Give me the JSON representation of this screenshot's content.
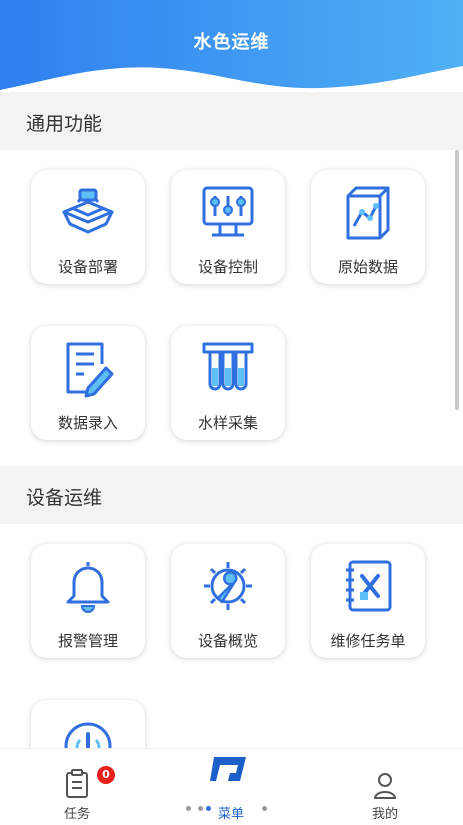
{
  "header": {
    "title": "水色运维"
  },
  "sections": [
    {
      "title": "通用功能",
      "items": [
        {
          "label": "设备部署",
          "icon": "device-deploy-icon"
        },
        {
          "label": "设备控制",
          "icon": "device-control-icon"
        },
        {
          "label": "原始数据",
          "icon": "raw-data-icon"
        },
        {
          "label": "数据录入",
          "icon": "data-entry-icon"
        },
        {
          "label": "水样采集",
          "icon": "water-sample-icon"
        }
      ]
    },
    {
      "title": "设备运维",
      "items": [
        {
          "label": "报警管理",
          "icon": "alarm-bell-icon"
        },
        {
          "label": "设备概览",
          "icon": "device-overview-icon"
        },
        {
          "label": "维修任务单",
          "icon": "repair-task-icon"
        },
        {
          "label": "",
          "icon": "power-icon"
        }
      ]
    }
  ],
  "tabbar": {
    "tasks": {
      "label": "任务",
      "badge": "0"
    },
    "menu": {
      "label": "菜单"
    },
    "mine": {
      "label": "我的"
    }
  },
  "colors": {
    "accent": "#2f6fe0",
    "header_blue": "#3d8ff0",
    "badge_red": "#e8211a"
  }
}
